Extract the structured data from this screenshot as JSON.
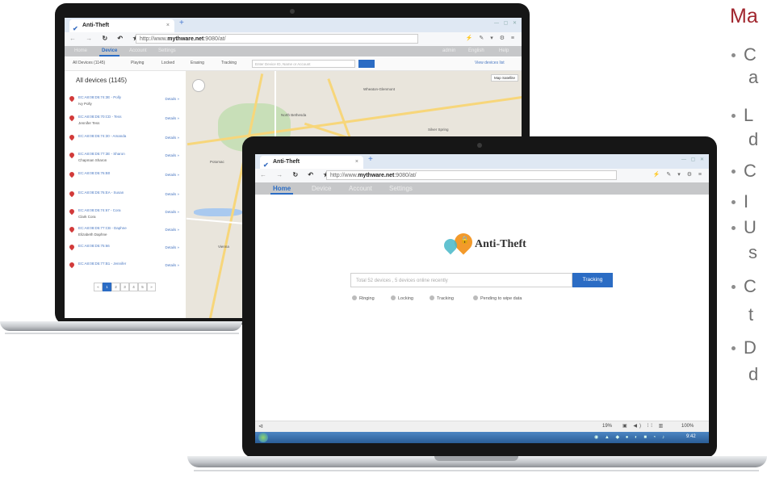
{
  "section": {
    "heading": "Ma",
    "bullets": [
      {
        "line1": "C",
        "line2": "a"
      },
      {
        "line1": "L",
        "line2": "d"
      },
      {
        "line1": "C",
        "line2": ""
      },
      {
        "line1": "I",
        "line2": ""
      },
      {
        "line1": "U",
        "line2": "s"
      },
      {
        "line1": "C",
        "line2": "t"
      },
      {
        "line1": "D",
        "line2": "d"
      }
    ]
  },
  "back_laptop": {
    "tab_title": "Anti-Theft",
    "url_prefix": "http://www.",
    "url_host": "mythware.net",
    "url_suffix": ":9080/at/",
    "nav": [
      "Home",
      "Device",
      "Account",
      "Settings"
    ],
    "nav_active": "Device",
    "user_menu": [
      "admin",
      "English",
      "Help"
    ],
    "filters": [
      "All Devices (1145)",
      "Playing",
      "Locked",
      "Erasing",
      "Tracking"
    ],
    "search_placeholder": "Enter Device ID, Name or Account",
    "view_link": "View devices list",
    "list_title": "All devices (1145)",
    "devices": [
      {
        "id": "EC:A8:08:D5:74:3E - Polly",
        "user": "Ivy Polly",
        "action": "Details »"
      },
      {
        "id": "EC:A8:08:D5:70:CD - Tess",
        "user": "Jennifer Tess",
        "action": "Details »"
      },
      {
        "id": "EC:A8:08:D5:74:30 - Amanda",
        "user": "",
        "action": "Details »"
      },
      {
        "id": "EC:A8:08:D5:77:3E - Sharon",
        "user": "Chapman Sharon",
        "action": "Details »"
      },
      {
        "id": "EC:A8:08:D5:76:B0",
        "user": "",
        "action": "Details »"
      },
      {
        "id": "EC:A8:08:D5:76:EA - Susan",
        "user": "",
        "action": "Details »"
      },
      {
        "id": "EC:A8:08:D5:74:67 - Cora",
        "user": "Clark Cora",
        "action": "Details »"
      },
      {
        "id": "EC:A8:08:D5:77:CB - Daphne",
        "user": "Elizabeth Daphne",
        "action": "Details »"
      },
      {
        "id": "EC:A8:08:D5:75:66",
        "user": "",
        "action": "Details »"
      },
      {
        "id": "EC:A8:08:D5:77:B1 - Jennifer",
        "user": "",
        "action": "Details »"
      }
    ],
    "pages": [
      "«",
      "1",
      "2",
      "3",
      "4",
      "5",
      "»"
    ],
    "map_toggle": "Map  Satellite",
    "map_labels": [
      "North Bethesda",
      "Wheaton-Glenmont",
      "Silver Spring",
      "McLean",
      "Falls Church",
      "Potomac",
      "Vienna"
    ]
  },
  "front_laptop": {
    "tab_title": "Anti-Theft",
    "url_prefix": "http://www.",
    "url_host": "mythware.net",
    "url_suffix": ":9080/at/",
    "nav": [
      "Home",
      "Device",
      "Account",
      "Settings"
    ],
    "nav_active": "Home",
    "app_name": "Anti-Theft",
    "search_placeholder": "Total 52 devices , 5 devices online recently",
    "search_button": "Tracking",
    "legend": [
      "Ringing",
      "Locking",
      "Tracking",
      "Pending to wipe data"
    ],
    "zoom": "100%",
    "status_left": "19%",
    "clock": "9:42"
  },
  "colors": {
    "accent": "#2b6cc4",
    "heading": "#a1262e",
    "bullet_text": "#707070",
    "pin": "#d23a3a",
    "logo_orange": "#f39a2b",
    "logo_teal": "#47b7c8"
  }
}
